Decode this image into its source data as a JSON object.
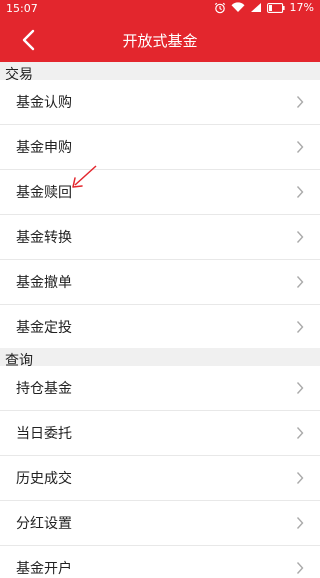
{
  "status_bar": {
    "time": "15:07",
    "battery": "17%"
  },
  "nav": {
    "title": "开放式基金"
  },
  "sections": [
    {
      "label": "交易",
      "items": [
        "基金认购",
        "基金申购",
        "基金赎回",
        "基金转换",
        "基金撤单",
        "基金定投"
      ]
    },
    {
      "label": "查询",
      "items": [
        "持仓基金",
        "当日委托",
        "历史成交",
        "分红设置",
        "基金开户"
      ]
    }
  ],
  "icons": [
    "back-arrow-icon",
    "alarm-icon",
    "wifi-icon",
    "signal-icon",
    "battery-icon",
    "chevron-right-icon"
  ],
  "colors": {
    "accent": "#e3262d",
    "section_bg": "#f0f0f0"
  }
}
